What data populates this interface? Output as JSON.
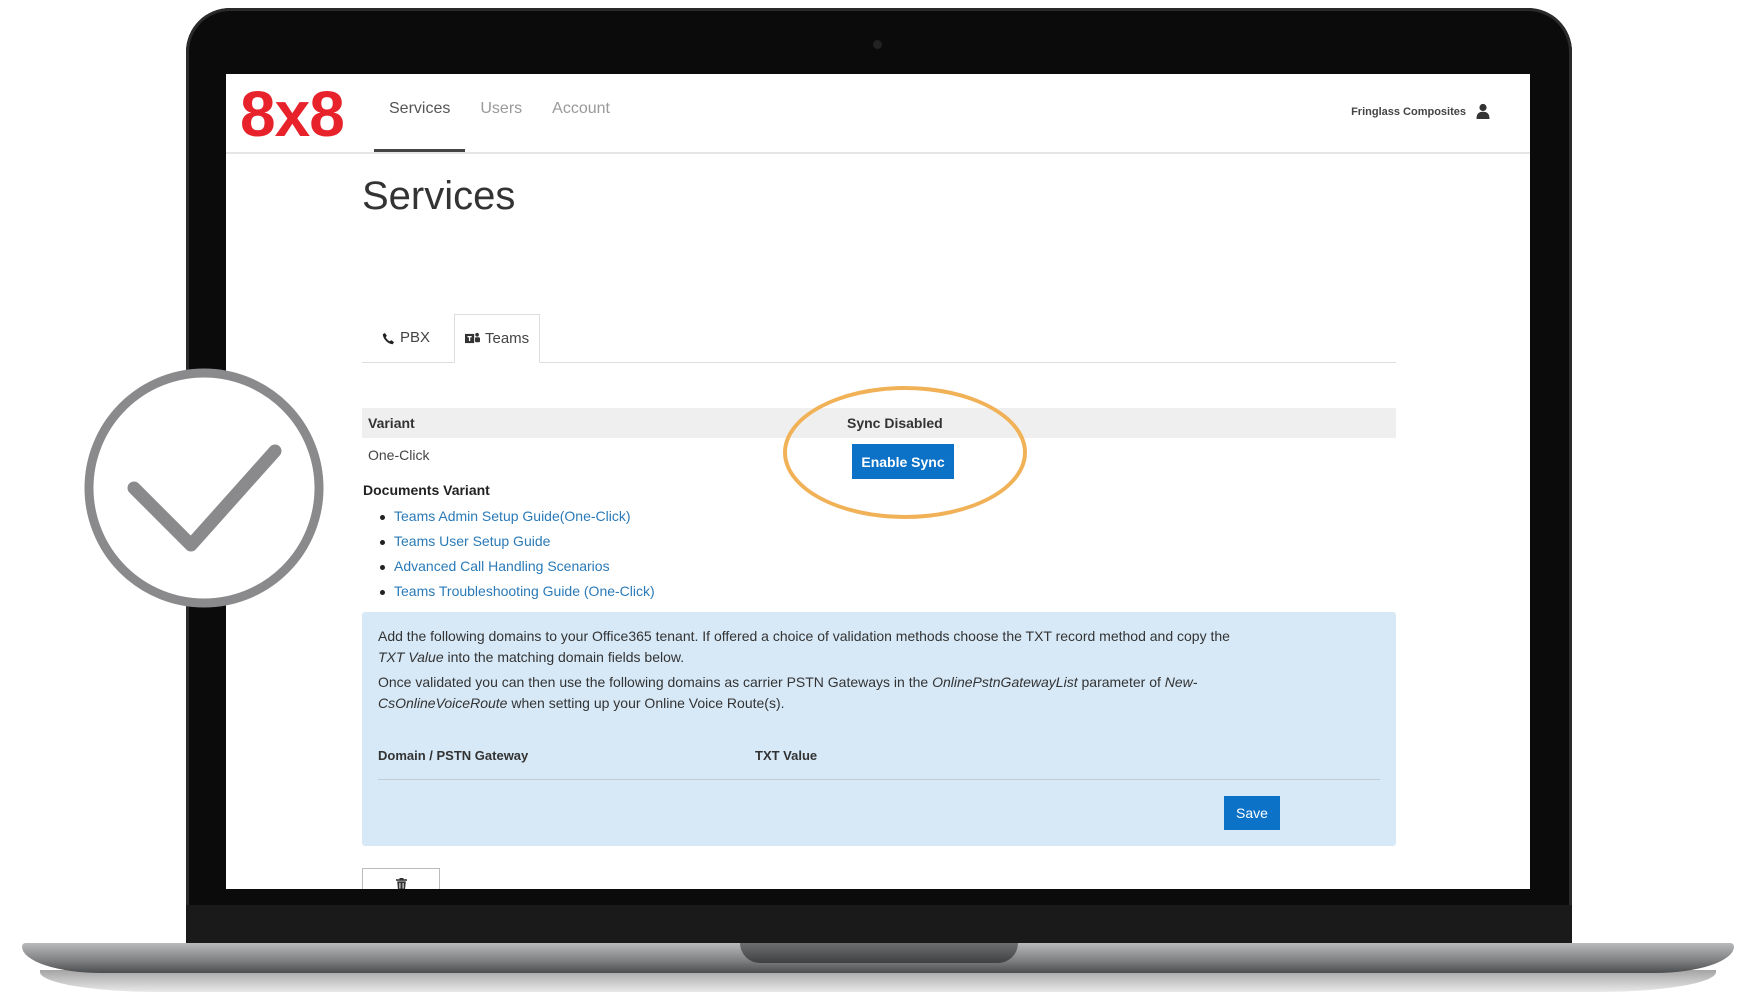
{
  "app": {
    "logo_text": "8x8",
    "brand_color": "#e8222b",
    "accent_color": "#0b72c8",
    "highlight_color": "#f0ad4e"
  },
  "nav": {
    "items": [
      {
        "label": "Services",
        "active": true
      },
      {
        "label": "Users",
        "active": false
      },
      {
        "label": "Account",
        "active": false
      }
    ]
  },
  "header": {
    "company_name": "Fringlass Composites",
    "user_icon": "user-icon"
  },
  "page": {
    "title": "Services"
  },
  "tabs": [
    {
      "label": "PBX",
      "icon": "phone-icon",
      "active": false
    },
    {
      "label": "Teams",
      "icon": "teams-icon",
      "active": true
    }
  ],
  "variant": {
    "label": "Variant",
    "value": "One-Click",
    "sync_status": "Sync Disabled",
    "enable_sync_label": "Enable Sync"
  },
  "documents": {
    "title": "Documents Variant",
    "links": [
      "Teams Admin Setup Guide(One-Click)",
      "Teams User Setup Guide",
      "Advanced Call Handling Scenarios",
      "Teams Troubleshooting Guide (One-Click)"
    ]
  },
  "info": {
    "p1_a": "Add the following domains to your Office365 tenant. If offered a choice of validation methods choose the TXT record method and copy the ",
    "p1_em": "TXT Value",
    "p1_b": " into the matching domain fields below.",
    "p2_a": "Once validated you can then use the following domains as carrier PSTN Gateways in the ",
    "p2_em1": "OnlinePstnGatewayList",
    "p2_b": " parameter of ",
    "p2_em2": "New-CsOnlineVoiceRoute",
    "p2_c": " when setting up your Online Voice Route(s).",
    "col_domain": "Domain / PSTN Gateway",
    "col_txt": "TXT Value",
    "save_label": "Save"
  },
  "actions": {
    "delete_icon": "trash-icon"
  },
  "badge": {
    "icon": "checkmark-icon"
  }
}
